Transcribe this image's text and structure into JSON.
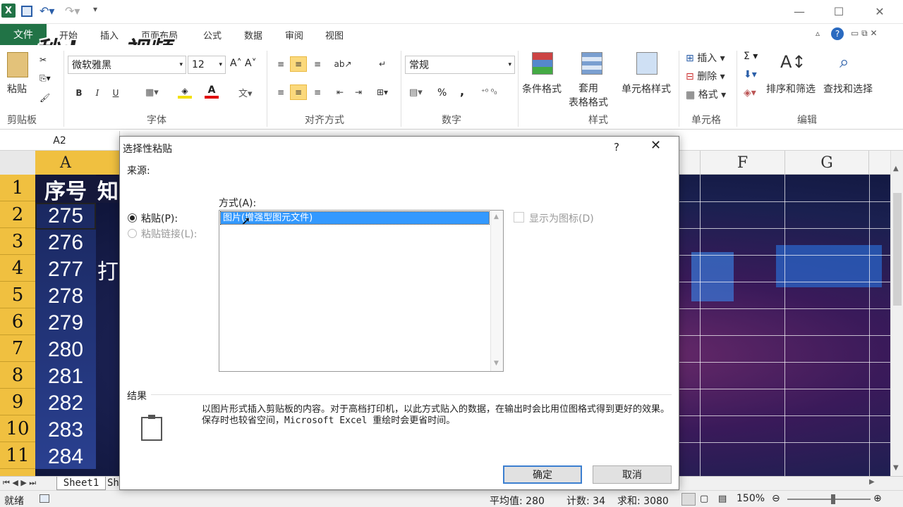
{
  "app": {
    "qat_icons": [
      "save-icon",
      "undo-icon",
      "redo-icon"
    ],
    "tabs": [
      "开始",
      "插入",
      "页面布局",
      "公式",
      "数据",
      "审阅",
      "视图"
    ],
    "file_tab": "文件",
    "watermark": "秒dong视频"
  },
  "ribbon": {
    "clipboard": {
      "paste": "粘贴",
      "label": "剪贴板"
    },
    "font": {
      "name": "微软雅黑",
      "size": "12",
      "bold": "B",
      "italic": "I",
      "underline": "U",
      "label": "字体"
    },
    "alignment": {
      "label": "对齐方式"
    },
    "number": {
      "format": "常规",
      "percent": "%",
      "comma": ",",
      "label": "数字"
    },
    "styles": {
      "conditional": "条件格式",
      "table_format": "套用\n表格格式",
      "cell_styles": "单元格样式",
      "label": "样式"
    },
    "cells": {
      "insert": "插入",
      "delete": "删除",
      "format": "格式",
      "label": "单元格"
    },
    "editing": {
      "sort_filter": "排序和筛选",
      "find_select": "查找和选择",
      "label": "编辑"
    }
  },
  "formula_bar": {
    "name_box": "A2"
  },
  "sheet": {
    "columns": [
      "A",
      "F",
      "G"
    ],
    "rows": [
      "1",
      "2",
      "3",
      "4",
      "5",
      "6",
      "7",
      "8",
      "9",
      "10",
      "11"
    ],
    "header_cells": [
      "序号",
      "知"
    ],
    "values": [
      "275",
      "276",
      "277",
      "278",
      "279",
      "280",
      "281",
      "282",
      "283",
      "284"
    ],
    "row4_partial": "打"
  },
  "sheet_tabs": {
    "active": "Sheet1",
    "partial": "Sh"
  },
  "status": {
    "ready": "就绪",
    "average": "平均值: 280",
    "count": "计数: 34",
    "sum": "求和: 3080",
    "zoom": "150%"
  },
  "dialog": {
    "title": "选择性粘贴",
    "help": "?",
    "source_label": "来源:",
    "as_label": "方式(A):",
    "paste_option": "粘贴(P):",
    "paste_link_option": "粘贴链接(L):",
    "list_items": [
      "图片(增强型图元文件)"
    ],
    "display_as_icon": "显示为图标(D)",
    "result_label": "结果",
    "result_text": "以图片形式插入剪贴板的内容。对于高档打印机，以此方式贴入的数据，在输出时会比用位图格式得到更好的效果。保存时也较省空间，Microsoft Excel 重绘时会更省时间。",
    "ok": "确定",
    "cancel": "取消"
  }
}
